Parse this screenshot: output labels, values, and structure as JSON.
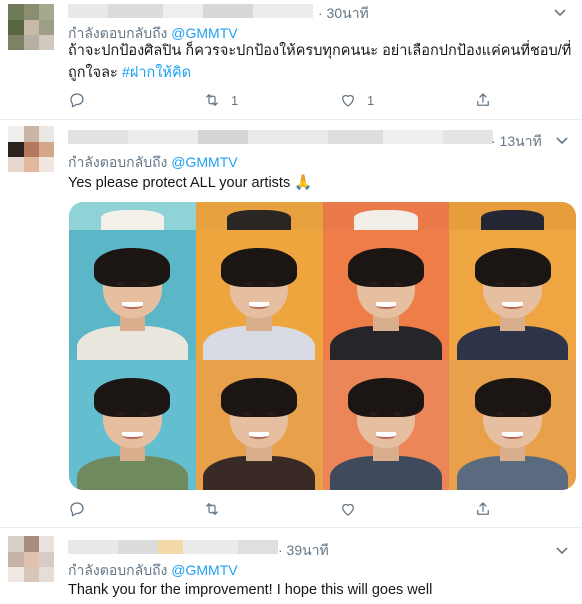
{
  "tweets": [
    {
      "time": "· 30นาที",
      "reply_prefix": "กำลังตอบกลับถึง",
      "reply_handle": "@GMMTV",
      "text_main": "ถ้าจะปกป้องศิลปิน ก็ควรจะปกป้องให้ครบทุกคนนะ อย่าเลือกปกป้องแค่คนที่ชอบ/ที่ถูกใจละ ",
      "hashtag": "#ฝากให้คิด",
      "actions": {
        "reply_count": "",
        "retweet_count": "1",
        "like_count": "1"
      }
    },
    {
      "time": "· 13นาที",
      "reply_prefix": "กำลังตอบกลับถึง",
      "reply_handle": "@GMMTV",
      "text_main": "Yes please protect ALL your artists 🙏",
      "actions": {
        "reply_count": "",
        "retweet_count": "",
        "like_count": ""
      }
    },
    {
      "time": "· 39นาที",
      "reply_prefix": "กำลังตอบกลับถึง",
      "reply_handle": "@GMMTV",
      "text_main": "Thank you for the improvement! I hope this will goes well"
    }
  ],
  "icons": {
    "reply": "reply-icon",
    "retweet": "retweet-icon",
    "like": "heart-icon",
    "share": "share-icon",
    "more": "chevron-down-icon"
  },
  "colors": {
    "link": "#1da1f2",
    "muted": "#657786",
    "text": "#14171a"
  }
}
